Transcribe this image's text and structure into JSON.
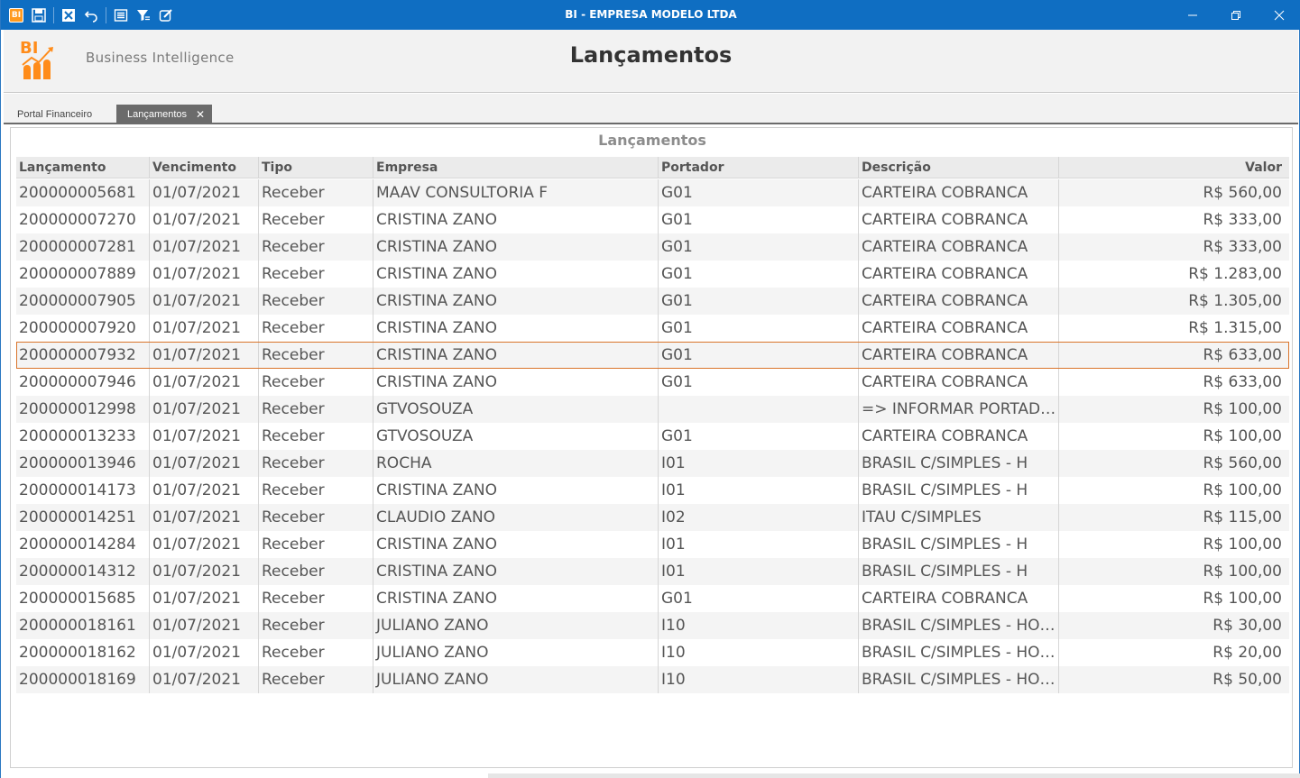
{
  "window": {
    "title": "BI - EMPRESA MODELO LTDA",
    "app_icon_text": "BI"
  },
  "header": {
    "logo_text": "BI",
    "brand": "Business Intelligence",
    "page_title": "Lançamentos"
  },
  "tabs": [
    {
      "label": "Portal Financeiro"
    },
    {
      "label": "Lançamentos"
    }
  ],
  "grid": {
    "caption": "Lançamentos",
    "columns": [
      "Lançamento",
      "Vencimento",
      "Tipo",
      "Empresa",
      "Portador",
      "Descrição",
      "Valor"
    ],
    "selected_index": 6,
    "rows": [
      [
        "200000005681",
        "01/07/2021",
        "Receber",
        "MAAV CONSULTORIA F",
        "G01",
        "CARTEIRA COBRANCA",
        "R$ 560,00"
      ],
      [
        "200000007270",
        "01/07/2021",
        "Receber",
        "CRISTINA ZANO",
        "G01",
        "CARTEIRA COBRANCA",
        "R$ 333,00"
      ],
      [
        "200000007281",
        "01/07/2021",
        "Receber",
        "CRISTINA ZANO",
        "G01",
        "CARTEIRA COBRANCA",
        "R$ 333,00"
      ],
      [
        "200000007889",
        "01/07/2021",
        "Receber",
        "CRISTINA ZANO",
        "G01",
        "CARTEIRA COBRANCA",
        "R$ 1.283,00"
      ],
      [
        "200000007905",
        "01/07/2021",
        "Receber",
        "CRISTINA ZANO",
        "G01",
        "CARTEIRA COBRANCA",
        "R$ 1.305,00"
      ],
      [
        "200000007920",
        "01/07/2021",
        "Receber",
        "CRISTINA ZANO",
        "G01",
        "CARTEIRA COBRANCA",
        "R$ 1.315,00"
      ],
      [
        "200000007932",
        "01/07/2021",
        "Receber",
        "CRISTINA ZANO",
        "G01",
        "CARTEIRA COBRANCA",
        "R$ 633,00"
      ],
      [
        "200000007946",
        "01/07/2021",
        "Receber",
        "CRISTINA ZANO",
        "G01",
        "CARTEIRA COBRANCA",
        "R$ 633,00"
      ],
      [
        "200000012998",
        "01/07/2021",
        "Receber",
        "GTVOSOUZA",
        "",
        "=> INFORMAR PORTADOR",
        "R$ 100,00"
      ],
      [
        "200000013233",
        "01/07/2021",
        "Receber",
        "GTVOSOUZA",
        "G01",
        "CARTEIRA COBRANCA",
        "R$ 100,00"
      ],
      [
        "200000013946",
        "01/07/2021",
        "Receber",
        "ROCHA",
        "I01",
        "BRASIL C/SIMPLES - H",
        "R$ 560,00"
      ],
      [
        "200000014173",
        "01/07/2021",
        "Receber",
        "CRISTINA ZANO",
        "I01",
        "BRASIL C/SIMPLES - H",
        "R$ 100,00"
      ],
      [
        "200000014251",
        "01/07/2021",
        "Receber",
        "CLAUDIO ZANO",
        "I02",
        "ITAU C/SIMPLES",
        "R$ 115,00"
      ],
      [
        "200000014284",
        "01/07/2021",
        "Receber",
        "CRISTINA ZANO",
        "I01",
        "BRASIL C/SIMPLES - H",
        "R$ 100,00"
      ],
      [
        "200000014312",
        "01/07/2021",
        "Receber",
        "CRISTINA ZANO",
        "I01",
        "BRASIL C/SIMPLES - H",
        "R$ 100,00"
      ],
      [
        "200000015685",
        "01/07/2021",
        "Receber",
        "CRISTINA ZANO",
        "G01",
        "CARTEIRA COBRANCA",
        "R$ 100,00"
      ],
      [
        "200000018161",
        "01/07/2021",
        "Receber",
        "JULIANO ZANO",
        "I10",
        "BRASIL C/SIMPLES - HOMOLOG",
        "R$ 30,00"
      ],
      [
        "200000018162",
        "01/07/2021",
        "Receber",
        "JULIANO ZANO",
        "I10",
        "BRASIL C/SIMPLES - HOMOLOG",
        "R$ 20,00"
      ],
      [
        "200000018169",
        "01/07/2021",
        "Receber",
        "JULIANO ZANO",
        "I10",
        "BRASIL C/SIMPLES - HOMOLOG",
        "R$ 50,00"
      ]
    ]
  },
  "colors": {
    "titlebar": "#0f6ec2",
    "brand_orange": "#ff8c1a",
    "selected_outline": "#d9742b",
    "tab_active": "#6b6b6b"
  }
}
